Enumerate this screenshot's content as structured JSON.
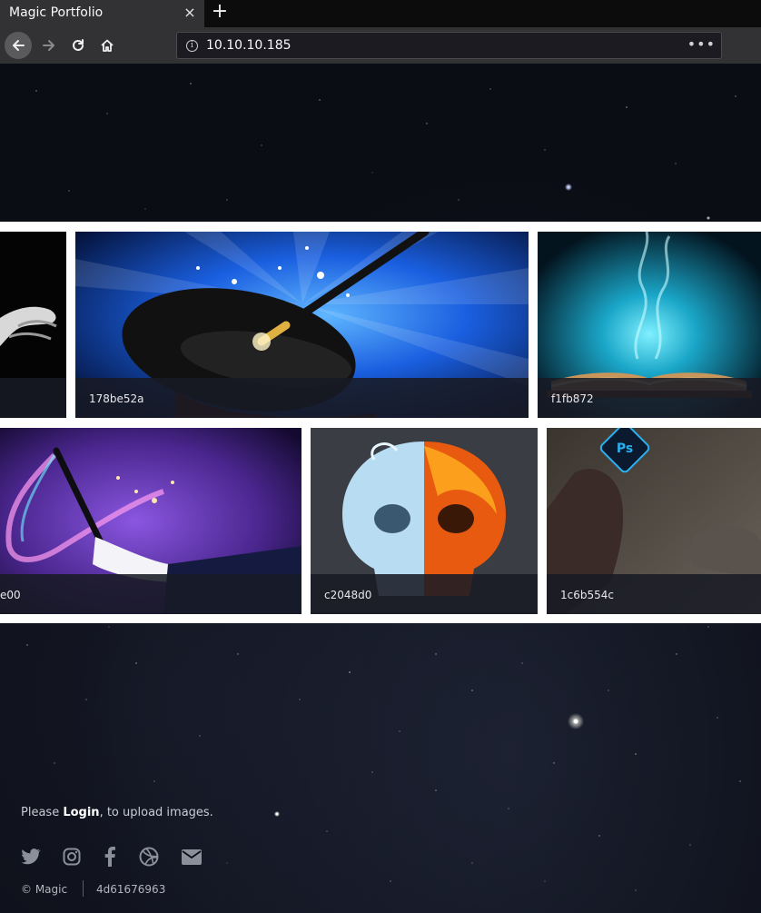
{
  "browser": {
    "tab_title": "Magic Portfolio",
    "tab_close": "×",
    "new_tab": "+",
    "url": "10.10.10.185",
    "url_more": "•••"
  },
  "gallery": {
    "cards": [
      {
        "label": "",
        "art": "hand"
      },
      {
        "label": "178be52a",
        "art": "magic-hat"
      },
      {
        "label": "f1fb872",
        "art": "magic-book"
      },
      {
        "label": "e00",
        "art": "wand-sparks"
      },
      {
        "label": "c2048d0",
        "art": "fire-ice-skull"
      },
      {
        "label": "1c6b554c",
        "art": "photoshop-hand"
      }
    ]
  },
  "footer": {
    "login_prefix": "Please ",
    "login_link": "Login",
    "login_suffix": ", to upload images.",
    "social_icons": [
      "twitter-icon",
      "instagram-icon",
      "facebook-icon",
      "dribbble-icon",
      "email-icon"
    ],
    "copyright": "© Magic",
    "hash": "4d61676963"
  },
  "colors": {
    "chrome_dark": "#0c0c0d",
    "chrome": "#323234",
    "page_bg": "#0b0d15",
    "gallery_bg": "#ffffff"
  }
}
